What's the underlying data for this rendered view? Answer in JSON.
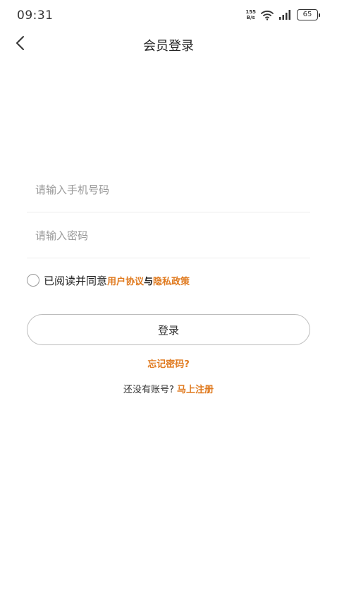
{
  "status_bar": {
    "time": "09:31",
    "net_speed_value": "155",
    "net_speed_unit": "B/s",
    "battery_level": "65"
  },
  "header": {
    "back_icon": "chevron-left-icon",
    "title": "会员登录"
  },
  "form": {
    "phone_placeholder": "请输入手机号码",
    "phone_value": "",
    "password_placeholder": "请输入密码",
    "password_value": ""
  },
  "agreement": {
    "checked": false,
    "prefix": "已阅读并同意",
    "user_agreement": "用户协议",
    "and": "与",
    "privacy_policy": "隐私政策"
  },
  "login_button": "登录",
  "forgot_password": "忘记密码?",
  "register": {
    "prompt": "还没有账号?",
    "link": "马上注册"
  },
  "colors": {
    "accent": "#e07a1f",
    "text": "#222222",
    "placeholder": "#9a9a9a",
    "divider": "#eeeeee",
    "button_border": "#bdbdbd"
  }
}
